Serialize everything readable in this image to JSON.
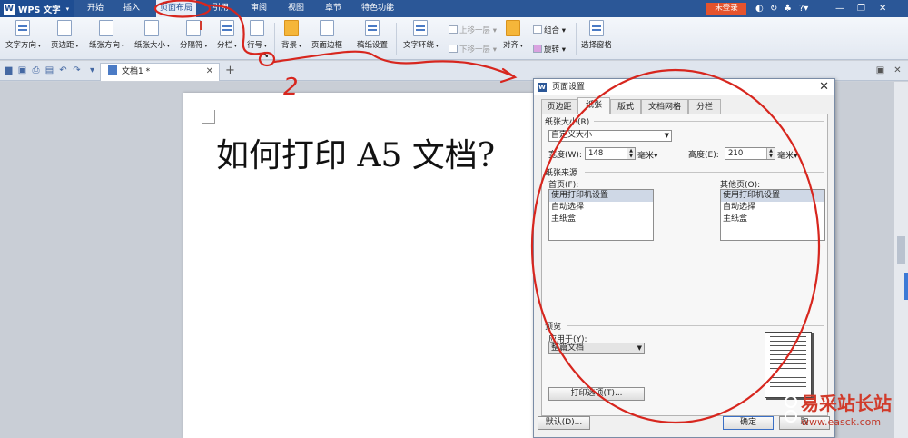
{
  "app": {
    "name": "WPS 文字"
  },
  "menu": [
    "开始",
    "插入",
    "页面布局",
    "引用",
    "审阅",
    "视图",
    "章节",
    "特色功能"
  ],
  "login_label": "未登录",
  "ribbon": {
    "buttons": [
      "文字方向",
      "页边距",
      "纸张方向",
      "纸张大小",
      "分隔符",
      "分栏",
      "行号",
      "背景",
      "页面边框",
      "稿纸设置",
      "文字环绕",
      "对齐",
      "旋转",
      "选择窗格"
    ],
    "arrange": {
      "up": "上移一层",
      "down": "下移一层",
      "group": "组合"
    }
  },
  "doc_tab": {
    "name": "文档1 *"
  },
  "document": {
    "heading": "如何打印 A5 文档?"
  },
  "dialog": {
    "title": "页面设置",
    "tabs": [
      "页边距",
      "纸张",
      "版式",
      "文档网格",
      "分栏"
    ],
    "paper_size": {
      "group_label": "纸张大小(R)",
      "selected": "自定义大小",
      "width_label": "宽度(W):",
      "width_value": "148",
      "height_label": "高度(E):",
      "height_value": "210",
      "unit": "毫米"
    },
    "paper_source": {
      "group_label": "纸张来源",
      "first_page_label": "首页(F):",
      "other_pages_label": "其他页(O):",
      "options": [
        "使用打印机设置",
        "自动选择",
        "主纸盒"
      ]
    },
    "preview": {
      "group_label": "预览",
      "apply_label": "应用于(Y):",
      "apply_value": "整篇文档",
      "print_options_button": "打印选项(T)..."
    },
    "default_button": "默认(D)...",
    "ok_button": "确定",
    "cancel_button": "取"
  },
  "annotation": {
    "step_number": "2"
  },
  "watermark": {
    "text": "易采站长站",
    "url": "www.easck.com"
  },
  "colors": {
    "title_bar": "#2b5797",
    "annotation_red": "#d7261e",
    "login": "#e5532d"
  }
}
